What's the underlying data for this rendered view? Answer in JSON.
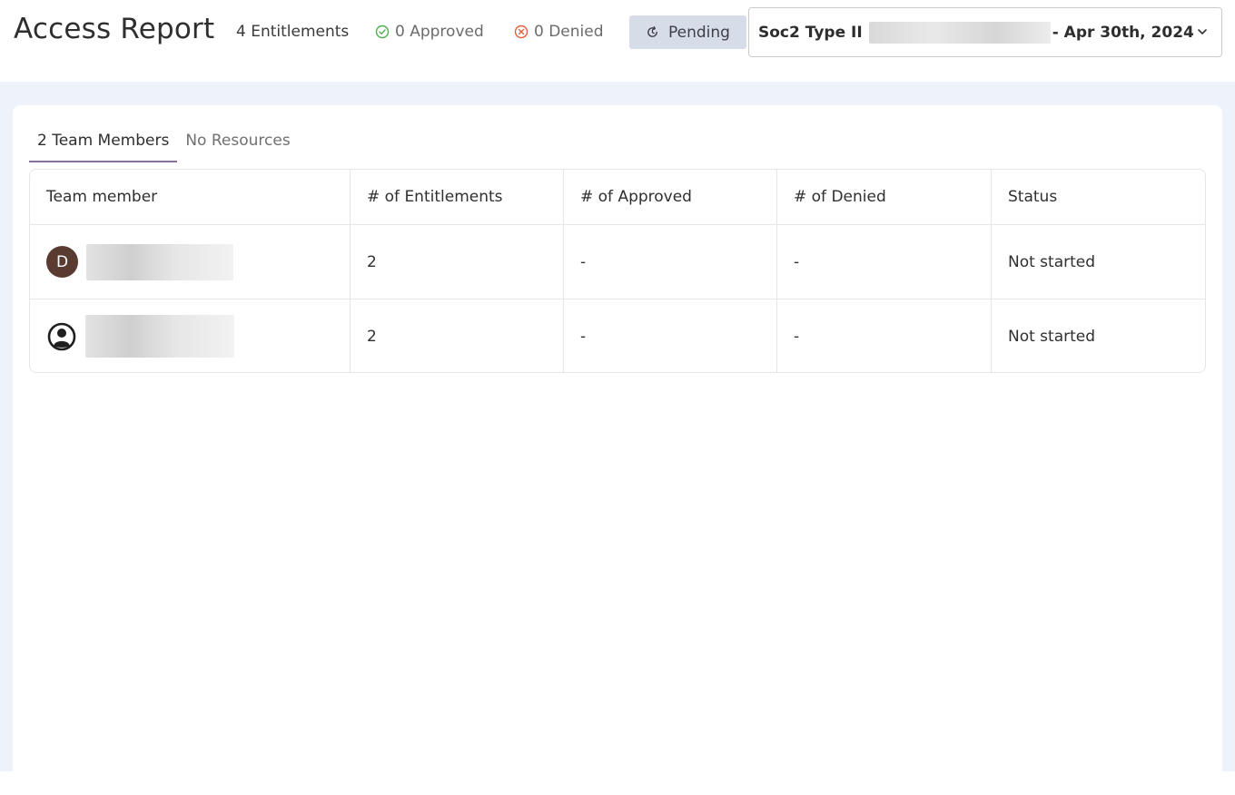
{
  "header": {
    "title": "Access Report",
    "entitlements": "4 Entitlements",
    "approved": "0 Approved",
    "denied": "0 Denied",
    "pending": "Pending",
    "audit_name": "Soc2 Type II",
    "audit_date": "- Apr 30th, 2024"
  },
  "tabs": [
    {
      "label": "2 Team Members",
      "active": true
    },
    {
      "label": "No Resources",
      "active": false
    }
  ],
  "table": {
    "columns": [
      "Team member",
      "# of Entitlements",
      "# of Approved",
      "# of Denied",
      "Status"
    ],
    "rows": [
      {
        "avatar": "D",
        "entitlements": "2",
        "approved": "-",
        "denied": "-",
        "status": "Not started"
      },
      {
        "avatar": "user-circle-icon",
        "entitlements": "2",
        "approved": "-",
        "denied": "-",
        "status": "Not started"
      }
    ]
  },
  "colors": {
    "approved": "#4caf50",
    "denied": "#e0603a",
    "pending_bg": "#d6dde9",
    "tab_underline": "#8a6f9a",
    "avatar_bg": "#5a3b32",
    "backdrop": "#eef2fb"
  }
}
